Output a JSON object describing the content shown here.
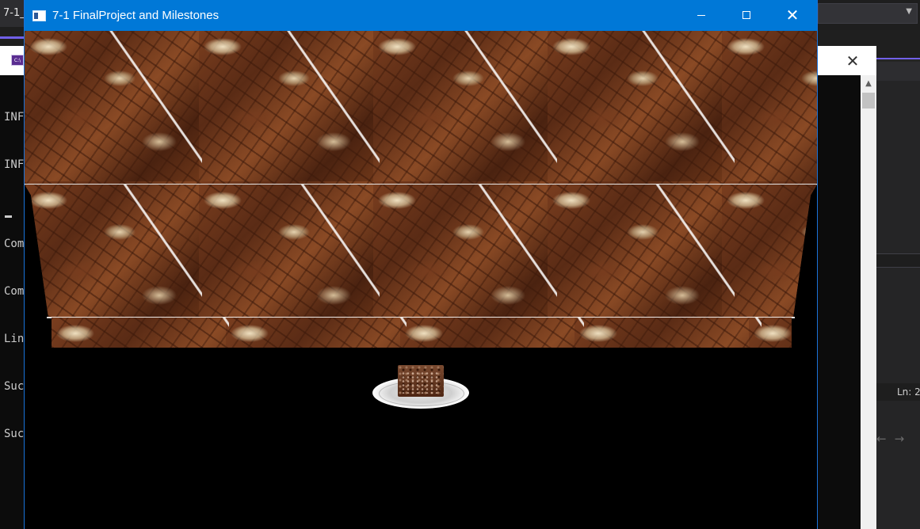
{
  "ide": {
    "tab_label": "7-1_",
    "status_label": "Ln: 2",
    "nav": {
      "back_icon": "arrow-left-icon",
      "forward_icon": "arrow-right-icon"
    },
    "accent_color": "#7160e8"
  },
  "console": {
    "icon_label": "C:\\",
    "lines": [
      "INF",
      "INF",
      "",
      "Com",
      "Com",
      "Lin",
      "Suc",
      "Suc"
    ]
  },
  "gl_window": {
    "title": "7-1 FinalProject and Milestones",
    "titlebar_color": "#0078d7",
    "minimize_label": "",
    "maximize_label": "",
    "close_label": "✕"
  }
}
